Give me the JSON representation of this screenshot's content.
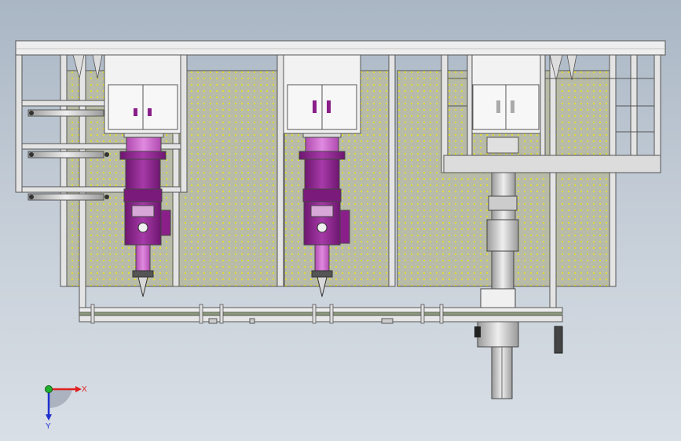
{
  "viewport": {
    "background_top": "#a9b6c4",
    "background_bottom": "#d9dfe6"
  },
  "axis_triad": {
    "x_label": "X",
    "y_label": "Y",
    "x_color": "#e02020",
    "y_color": "#2030d0",
    "z_color": "#20b030"
  },
  "colors": {
    "frame": "#e8e8e8",
    "frame_edge": "#5a5a5a",
    "mesh_panel": "#b9bdaa",
    "mesh_dot": "#e8e02a",
    "cabinet": "#f2f2f2",
    "spindle_purple": "#8a1f8a",
    "spindle_light": "#c85ac8",
    "rail_green": "#8a9a7a"
  },
  "icons": [
    "axis-triad-icon"
  ]
}
